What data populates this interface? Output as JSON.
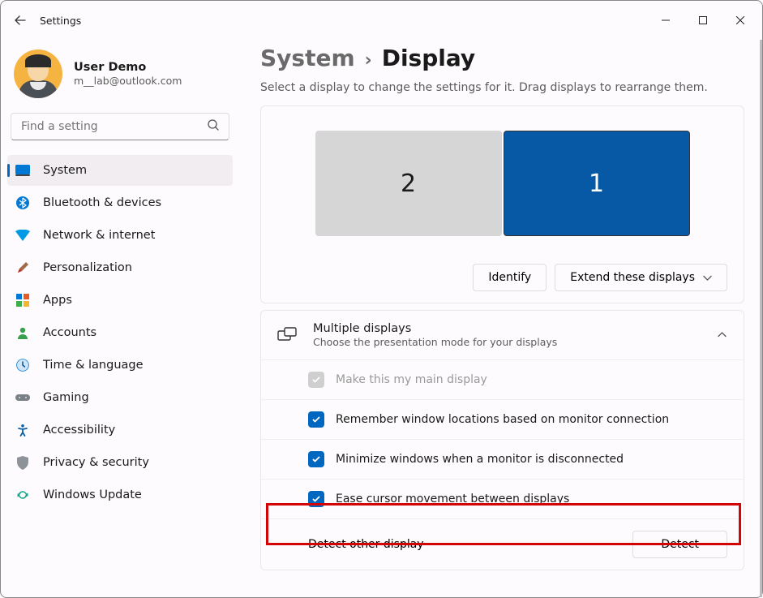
{
  "window": {
    "title": "Settings"
  },
  "profile": {
    "name": "User Demo",
    "email": "m__lab@outlook.com"
  },
  "search": {
    "placeholder": "Find a setting"
  },
  "sidebar": {
    "items": [
      {
        "label": "System",
        "icon": "system",
        "active": true
      },
      {
        "label": "Bluetooth & devices",
        "icon": "bluetooth"
      },
      {
        "label": "Network & internet",
        "icon": "wifi"
      },
      {
        "label": "Personalization",
        "icon": "brush"
      },
      {
        "label": "Apps",
        "icon": "apps"
      },
      {
        "label": "Accounts",
        "icon": "account"
      },
      {
        "label": "Time & language",
        "icon": "clock"
      },
      {
        "label": "Gaming",
        "icon": "gamepad"
      },
      {
        "label": "Accessibility",
        "icon": "accessibility"
      },
      {
        "label": "Privacy & security",
        "icon": "shield"
      },
      {
        "label": "Windows Update",
        "icon": "update"
      }
    ]
  },
  "breadcrumb": {
    "parent": "System",
    "current": "Display"
  },
  "description": "Select a display to change the settings for it. Drag displays to rearrange them.",
  "monitors": {
    "secondary_label": "2",
    "primary_label": "1"
  },
  "identify_button": "Identify",
  "extend_mode": "Extend these displays",
  "multi": {
    "title": "Multiple displays",
    "subtitle": "Choose the presentation mode for your displays",
    "options": [
      {
        "label": "Make this my main display",
        "checked": false,
        "disabled": true
      },
      {
        "label": "Remember window locations based on monitor connection",
        "checked": true
      },
      {
        "label": "Minimize windows when a monitor is disconnected",
        "checked": true
      },
      {
        "label": "Ease cursor movement between displays",
        "checked": true
      }
    ],
    "detect": {
      "label": "Detect other display",
      "button": "Detect"
    }
  }
}
